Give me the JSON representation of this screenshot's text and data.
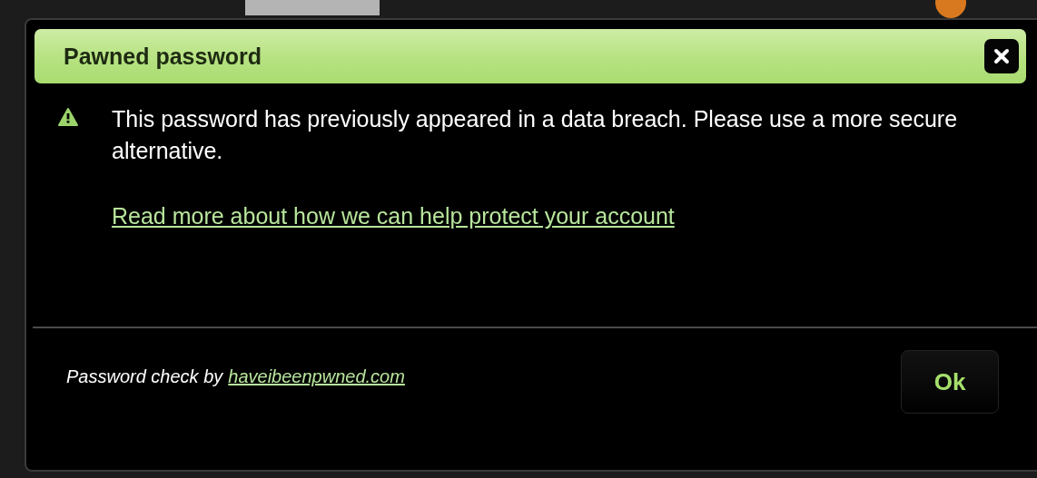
{
  "dialog": {
    "title": "Pawned password",
    "message": "This password has previously appeared in a data breach. Please use a more secure alternative.",
    "link": "Read more about how we can help protect your account",
    "footer": {
      "text": "Password check by",
      "link": "haveibeenpwned.com"
    },
    "buttons": [
      "Ok"
    ]
  }
}
